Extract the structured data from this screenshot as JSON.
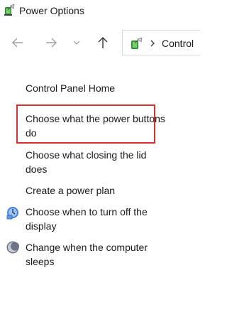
{
  "window": {
    "title": "Power Options"
  },
  "navbar": {
    "address": "Control"
  },
  "tasks": {
    "home": "Control Panel Home",
    "power_buttons": "Choose what the power buttons do",
    "closing_lid": "Choose what closing the lid does",
    "power_plan": "Create a power plan",
    "turn_off_display": "Choose when to turn off the display",
    "computer_sleeps": "Change when the computer sleeps"
  },
  "colors": {
    "highlight_border": "#d9312f",
    "text": "#1a1a1a",
    "nav_disabled": "#a0a0a0"
  },
  "icons": {
    "app": "power-options-icon",
    "back": "arrow-left-icon",
    "forward": "arrow-right-icon",
    "recent": "chevron-down-icon",
    "up": "arrow-up-icon",
    "address": "control-panel-icon",
    "address_separator": "chevron-right-icon",
    "display": "display-power-icon",
    "sleep": "moon-sleep-icon"
  }
}
